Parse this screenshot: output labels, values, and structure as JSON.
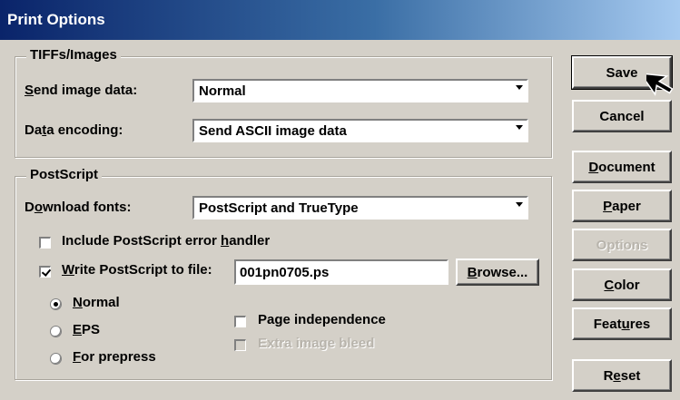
{
  "window": {
    "title": "Print Options"
  },
  "tiffs": {
    "title": "TIFFs/Images",
    "send_image_label": "Send image data:",
    "send_image_value": "Normal",
    "data_encoding_label": "Data encoding:",
    "data_encoding_value": "Send ASCII image data"
  },
  "postscript": {
    "title": "PostScript",
    "download_fonts_label": "Download fonts:",
    "download_fonts_value": "PostScript and TrueType",
    "include_error_handler_label": "Include PostScript error handler",
    "include_error_handler_checked": false,
    "write_to_file_label": "Write PostScript to file:",
    "write_to_file_checked": true,
    "file_name": "001pn0705.ps",
    "browse_label": "Browse...",
    "radio_normal": "Normal",
    "radio_eps": "EPS",
    "radio_prepress": "For prepress",
    "selected_mode": "Normal",
    "page_independence_label": "Page independence",
    "extra_image_bleed_label": "Extra image bleed"
  },
  "buttons": {
    "save": "Save",
    "cancel": "Cancel",
    "document": "Document",
    "paper": "Paper",
    "options": "Options",
    "color": "Color",
    "features": "Features",
    "reset": "Reset"
  },
  "icons": {
    "cursor": "arrow-cursor-icon"
  }
}
